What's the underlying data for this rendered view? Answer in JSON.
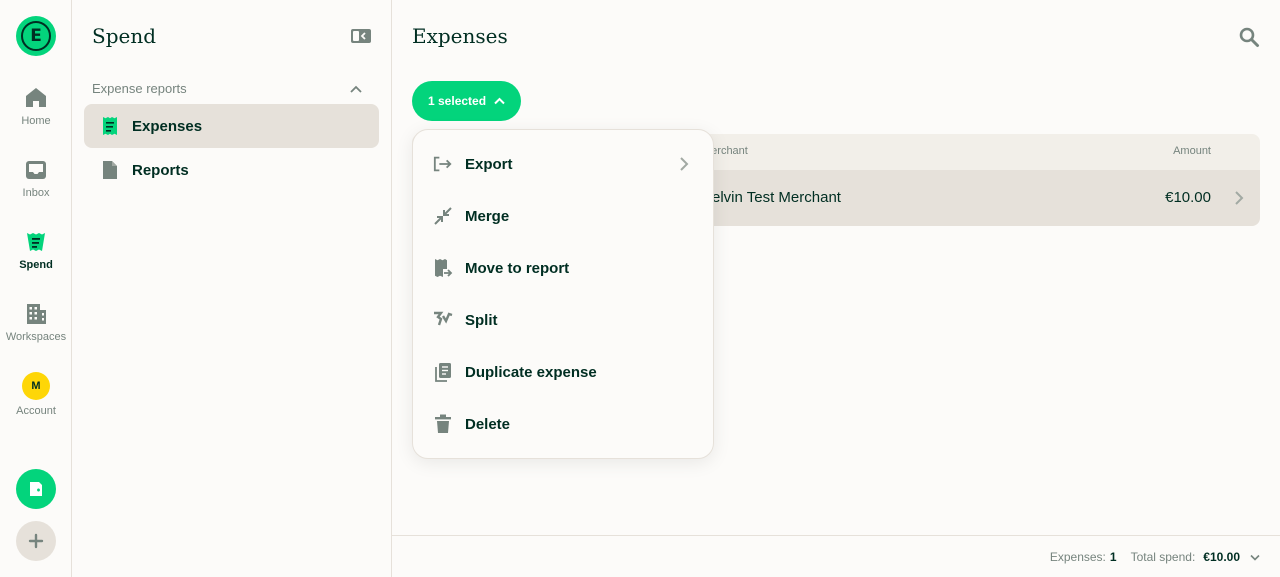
{
  "rail": {
    "logo_letter": "E",
    "items": [
      {
        "label": "Home",
        "icon": "home-icon"
      },
      {
        "label": "Inbox",
        "icon": "inbox-icon"
      },
      {
        "label": "Spend",
        "icon": "receipt-icon",
        "active": true
      },
      {
        "label": "Workspaces",
        "icon": "building-icon"
      },
      {
        "label": "Account",
        "icon": "avatar",
        "avatar_initial": "M"
      }
    ],
    "fab_new": "new-expense-icon",
    "fab_add": "plus-icon"
  },
  "sidebar": {
    "title": "Spend",
    "section_label": "Expense reports",
    "items": [
      {
        "label": "Expenses",
        "icon": "receipt-icon",
        "active": true
      },
      {
        "label": "Reports",
        "icon": "document-icon"
      }
    ]
  },
  "main": {
    "title": "Expenses",
    "selected_label": "1 selected",
    "table": {
      "columns": [
        "Merchant",
        "Amount"
      ],
      "rows": [
        {
          "merchant": "Kelvin Test Merchant",
          "amount": "€10.00"
        }
      ]
    },
    "footer": {
      "expenses_label": "Expenses:",
      "expenses_count": "1",
      "total_label": "Total spend:",
      "total_value": "€10.00"
    }
  },
  "menu": {
    "items": [
      {
        "label": "Export",
        "icon": "export-icon",
        "submenu": true
      },
      {
        "label": "Merge",
        "icon": "merge-icon"
      },
      {
        "label": "Move to report",
        "icon": "move-to-report-icon"
      },
      {
        "label": "Split",
        "icon": "split-icon"
      },
      {
        "label": "Duplicate expense",
        "icon": "duplicate-icon"
      },
      {
        "label": "Delete",
        "icon": "trash-icon"
      }
    ]
  },
  "colors": {
    "accent": "#03d47c",
    "text": "#002e22",
    "muted": "#76847e",
    "border": "#e6e1da",
    "background": "#fcfbf9",
    "avatar": "#fed607"
  }
}
